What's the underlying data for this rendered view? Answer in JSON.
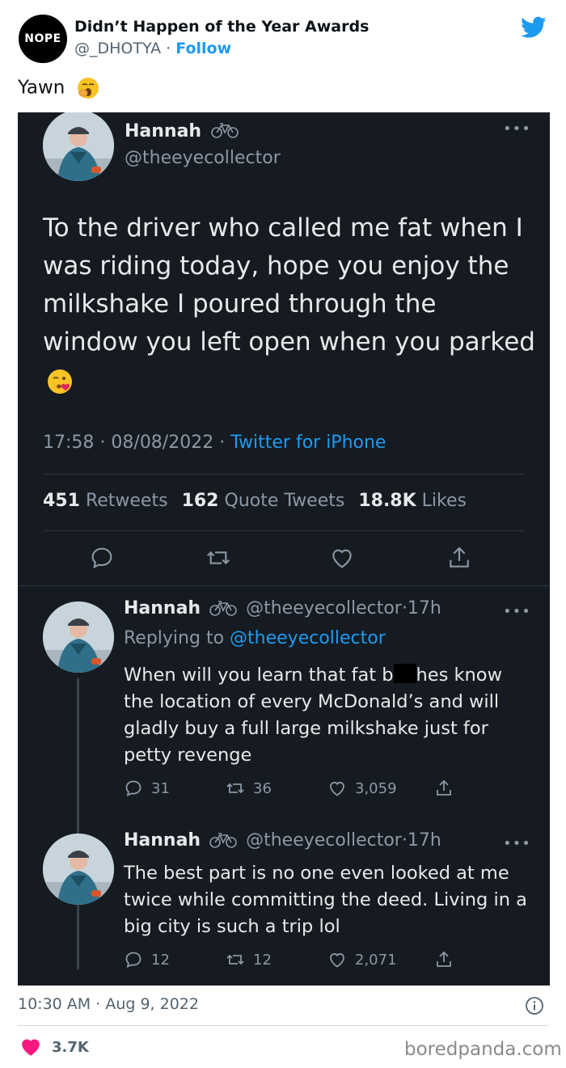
{
  "header": {
    "avatar_text": "NOPE",
    "account_name": "Didn’t Happen of the Year Awards",
    "handle": "@_DHOTYA",
    "separator": "·",
    "follow_label": "Follow"
  },
  "caption": {
    "text": "Yawn",
    "emoji": "yawning-face-emoji"
  },
  "screenshot": {
    "main_tweet": {
      "name": "Hannah",
      "name_icon": "bicycle-icon",
      "handle": "@theeyecollector",
      "more": "•••",
      "text": "To the driver who called me fat when I was riding today, hope you enjoy the milkshake I poured through the window you left open when you parked",
      "emoji": "face-blowing-kiss-emoji",
      "time": "17:58",
      "date": "08/08/2022",
      "source": "Twitter for iPhone",
      "dot": "·",
      "retweets": "451",
      "retweets_label": "Retweets",
      "quotes": "162",
      "quotes_label": "Quote Tweets",
      "likes": "18.8K",
      "likes_label": "Likes"
    },
    "replies": [
      {
        "name": "Hannah",
        "handle": "@theeyecollector",
        "age": "17h",
        "dot": "·",
        "more": "•••",
        "replying_prefix": "Replying to",
        "replying_to": "@theeyecollector",
        "text_before": "When will you learn that fat b",
        "text_after": "hes know the location of every McDonald’s and will gladly buy a full large milkshake just for petty revenge",
        "reply_count": "31",
        "retweet_count": "36",
        "like_count": "3,059"
      },
      {
        "name": "Hannah",
        "handle": "@theeyecollector",
        "age": "17h",
        "dot": "·",
        "more": "•••",
        "text": "The best part is no one even looked at me twice while committing the deed. Living in a big city is such a trip lol",
        "reply_count": "12",
        "retweet_count": "12",
        "like_count": "2,071"
      }
    ]
  },
  "footer": {
    "time": "10:30 AM",
    "separator": "·",
    "date": "Aug 9, 2022",
    "likes": "3.7K",
    "watermark": "boredpanda.com"
  },
  "colors": {
    "accent": "#1d9bf0",
    "dark_bg": "#161b22",
    "like_red": "#f91880"
  }
}
